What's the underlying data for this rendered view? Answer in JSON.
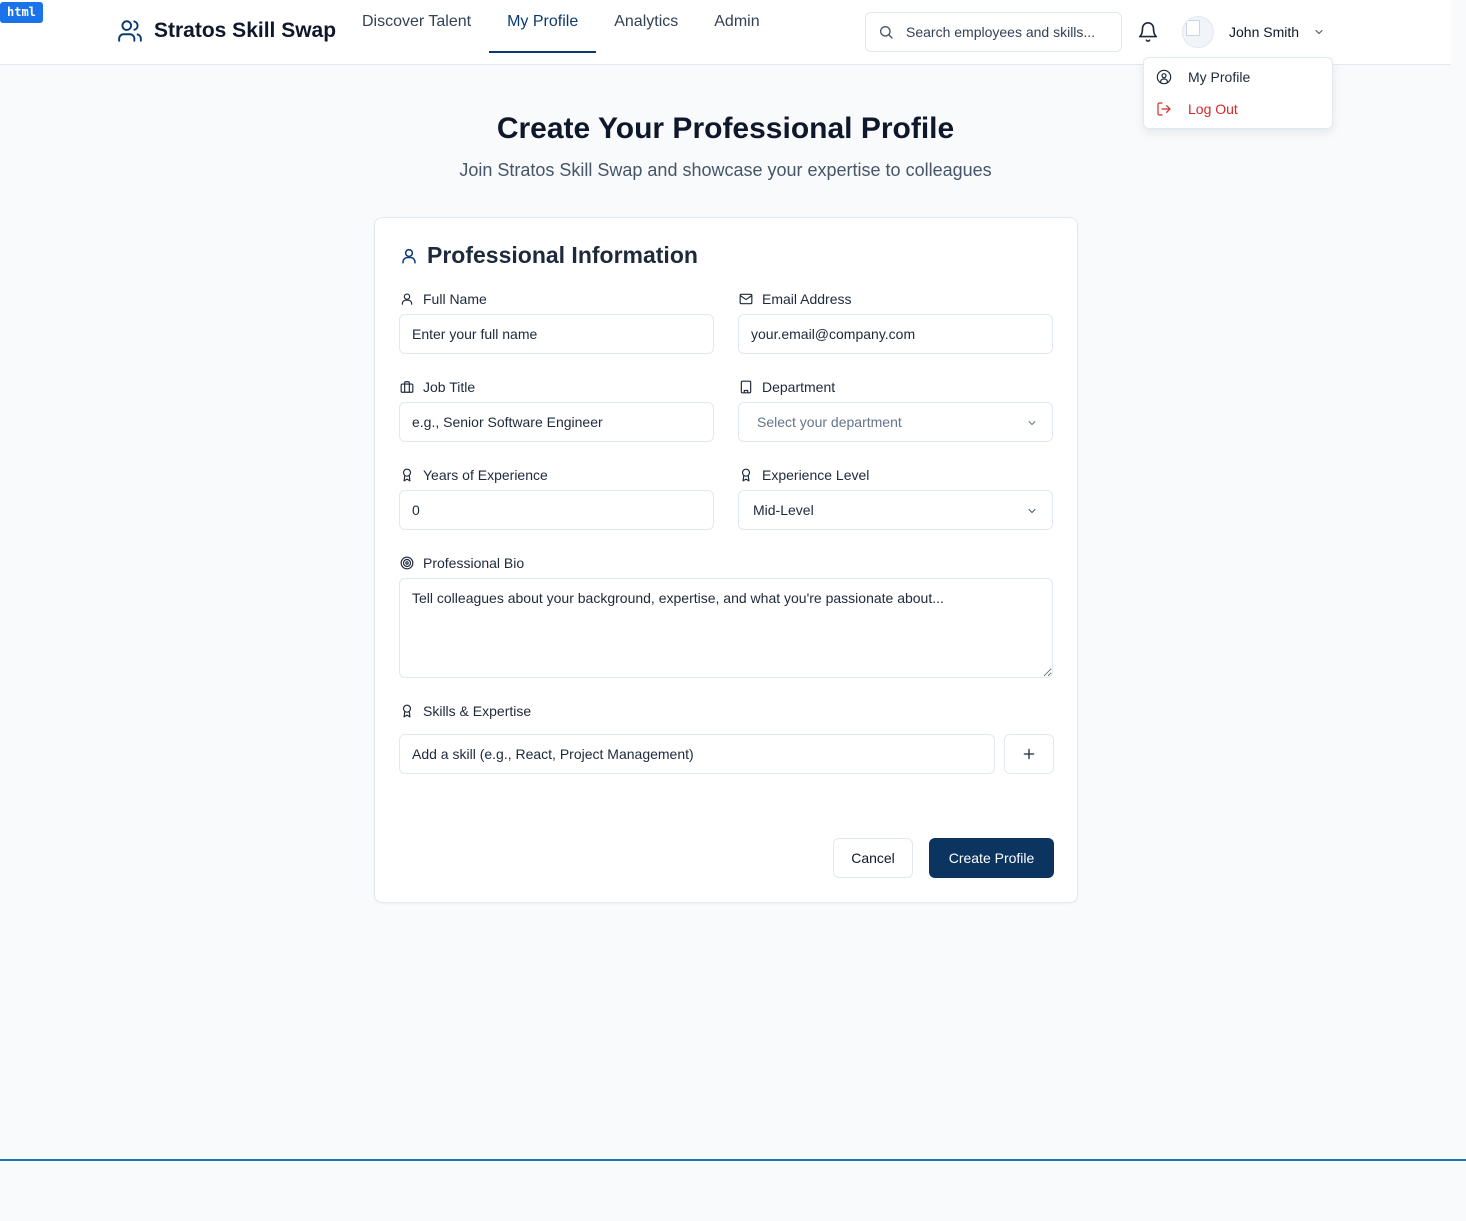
{
  "dev_tag": "html",
  "header": {
    "brand": "Stratos Skill Swap",
    "nav": [
      {
        "label": "Discover Talent",
        "active": false
      },
      {
        "label": "My Profile",
        "active": true
      },
      {
        "label": "Analytics",
        "active": false
      },
      {
        "label": "Admin",
        "active": false
      }
    ],
    "search_placeholder": "Search employees and skills...",
    "user_name": "John Smith"
  },
  "user_menu": {
    "my_profile": "My Profile",
    "log_out": "Log Out"
  },
  "hero": {
    "title": "Create Your Professional Profile",
    "subtitle": "Join Stratos Skill Swap and showcase your expertise to colleagues"
  },
  "form": {
    "section_title": "Professional Information",
    "full_name": {
      "label": "Full Name",
      "placeholder": "Enter your full name"
    },
    "email": {
      "label": "Email Address",
      "placeholder": "your.email@company.com"
    },
    "job_title": {
      "label": "Job Title",
      "placeholder": "e.g., Senior Software Engineer"
    },
    "department": {
      "label": "Department",
      "placeholder": "Select your department"
    },
    "years": {
      "label": "Years of Experience",
      "value": "0"
    },
    "level": {
      "label": "Experience Level",
      "value": "Mid-Level"
    },
    "bio": {
      "label": "Professional Bio",
      "placeholder": "Tell colleagues about your background, expertise, and what you're passionate about..."
    },
    "skills": {
      "label": "Skills & Expertise",
      "placeholder": "Add a skill (e.g., React, Project Management)"
    },
    "cancel_label": "Cancel",
    "submit_label": "Create Profile"
  },
  "colors": {
    "primary": "#0b3461",
    "danger": "#dc2626",
    "background": "#f8fafc"
  }
}
